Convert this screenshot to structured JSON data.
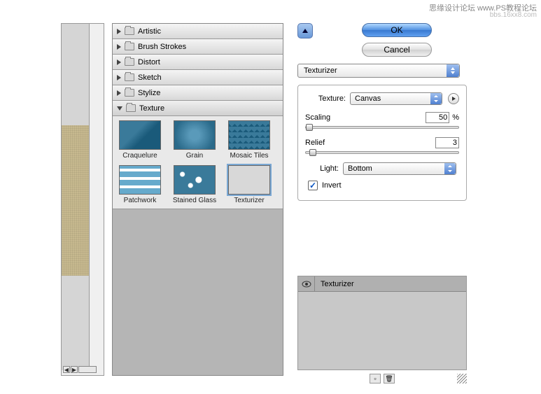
{
  "watermark": {
    "line1": "思缘设计论坛 www.PS教程论坛",
    "line2": "bbs.16xx8.com"
  },
  "categories": [
    {
      "label": "Artistic",
      "expanded": false
    },
    {
      "label": "Brush Strokes",
      "expanded": false
    },
    {
      "label": "Distort",
      "expanded": false
    },
    {
      "label": "Sketch",
      "expanded": false
    },
    {
      "label": "Stylize",
      "expanded": false
    },
    {
      "label": "Texture",
      "expanded": true
    }
  ],
  "thumbs": [
    {
      "label": "Craquelure"
    },
    {
      "label": "Grain"
    },
    {
      "label": "Mosaic Tiles"
    },
    {
      "label": "Patchwork"
    },
    {
      "label": "Stained Glass"
    },
    {
      "label": "Texturizer"
    }
  ],
  "buttons": {
    "ok": "OK",
    "cancel": "Cancel"
  },
  "filter_select": "Texturizer",
  "texture": {
    "label": "Texture:",
    "value": "Canvas",
    "scaling_label": "Scaling",
    "scaling_value": "50",
    "scaling_unit": "%",
    "relief_label": "Relief",
    "relief_value": "3",
    "light_label": "Light:",
    "light_value": "Bottom",
    "invert_label": "Invert",
    "invert_checked": true
  },
  "layers": {
    "item": "Texturizer"
  }
}
